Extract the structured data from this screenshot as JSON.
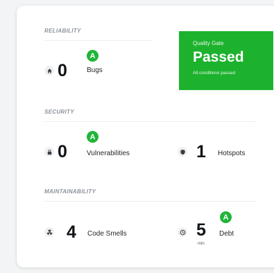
{
  "reliability": {
    "label": "RELIABILITY",
    "bugs": {
      "value": "0",
      "label": "Bugs",
      "rating": "A",
      "icon": "bug-icon"
    }
  },
  "quality_gate": {
    "title": "Quality Gate",
    "status": "Passed",
    "description": "All conditions passed",
    "color": "#1db22e"
  },
  "security": {
    "label": "SECURITY",
    "vulnerabilities": {
      "value": "0",
      "label": "Vulnerabilities",
      "rating": "A",
      "icon": "lock-icon"
    },
    "hotspots": {
      "value": "1",
      "label": "Hotspots",
      "icon": "shield-icon"
    }
  },
  "maintainability": {
    "label": "MAINTAINABILITY",
    "code_smells": {
      "value": "4",
      "label": "Code Smells",
      "icon": "radiation-icon"
    },
    "debt": {
      "value": "5",
      "unit": "min",
      "label": "Debt",
      "rating": "A",
      "icon": "clock-icon"
    }
  },
  "colors": {
    "rating_a": "#20b53a",
    "gate_passed": "#1db22e"
  }
}
